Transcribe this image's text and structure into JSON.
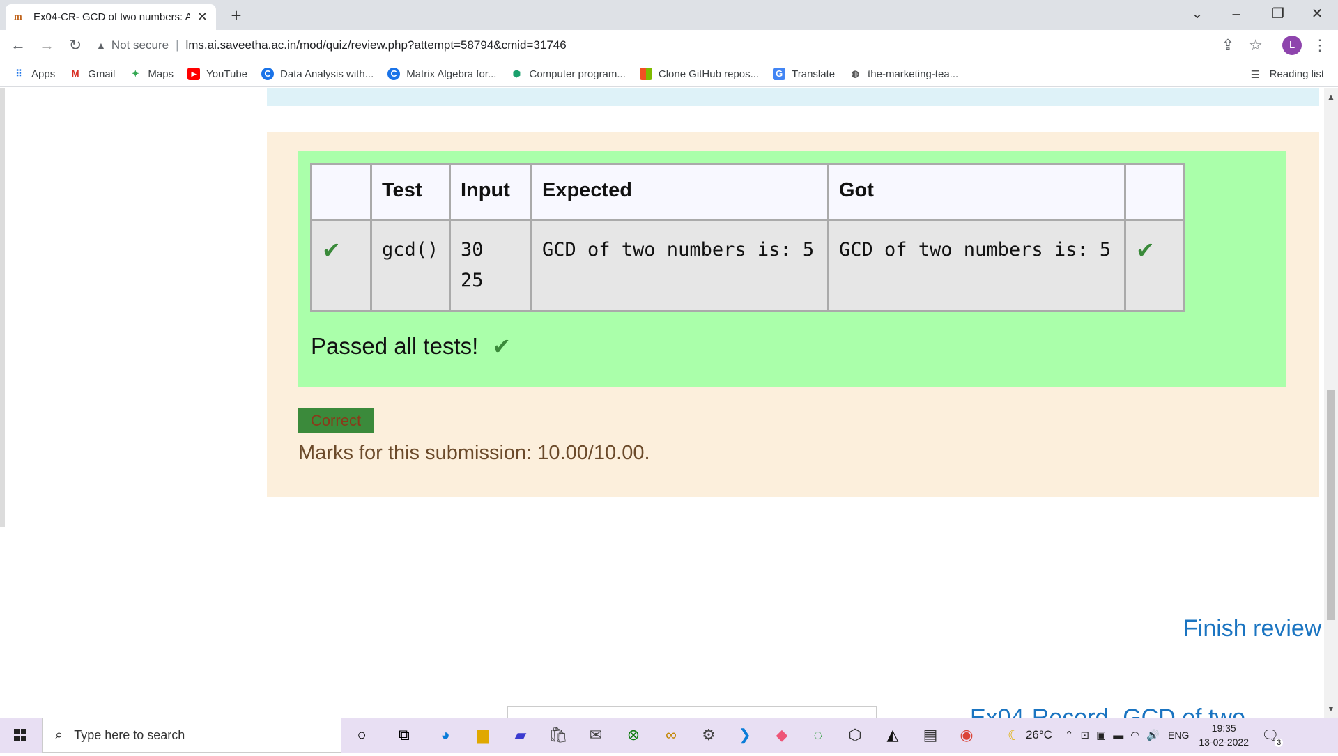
{
  "browser": {
    "tab_title": "Ex04-CR- GCD of two numbers: A",
    "tab_favicon": "m",
    "url_security": "Not secure",
    "url_separator": "|",
    "url": "lms.ai.saveetha.ac.in/mod/quiz/review.php?attempt=58794&cmid=31746",
    "profile_initial": "L"
  },
  "bookmarks": [
    {
      "label": "Apps",
      "icon": "apps-grid-icon"
    },
    {
      "label": "Gmail",
      "icon": "gmail-icon"
    },
    {
      "label": "Maps",
      "icon": "maps-icon"
    },
    {
      "label": "YouTube",
      "icon": "youtube-icon"
    },
    {
      "label": "Data Analysis with...",
      "icon": "coursera-icon"
    },
    {
      "label": "Matrix Algebra for...",
      "icon": "coursera-icon"
    },
    {
      "label": "Computer program...",
      "icon": "shield-check-icon"
    },
    {
      "label": "Clone GitHub repos...",
      "icon": "microsoft-icon"
    },
    {
      "label": "Translate",
      "icon": "translate-icon"
    },
    {
      "label": "the-marketing-tea...",
      "icon": "globe-icon"
    }
  ],
  "reading_list": "Reading list",
  "results_table": {
    "headers": [
      "",
      "Test",
      "Input",
      "Expected",
      "Got",
      ""
    ],
    "row": {
      "test": "gcd()",
      "input_line1": "30",
      "input_line2": "25",
      "expected": "GCD of two numbers is: 5",
      "got": "GCD of two numbers is: 5"
    }
  },
  "tick_glyph": "✔",
  "passed_text": "Passed all tests!",
  "correct_badge": "Correct",
  "marks_text": "Marks for this submission: 10.00/10.00.",
  "finish_review": "Finish review",
  "next_link": "Ex04-Record- GCD of two",
  "taskbar": {
    "search_placeholder": "Type here to search",
    "temperature": "26°C",
    "language": "ENG",
    "time": "19:35",
    "date": "13-02-2022",
    "notification_count": "3"
  },
  "colors": {
    "pass_green": "#aaffaa",
    "outcome_bg": "#fcefdc",
    "link_blue": "#1a74c1",
    "tick_green": "#3a8a3a"
  }
}
